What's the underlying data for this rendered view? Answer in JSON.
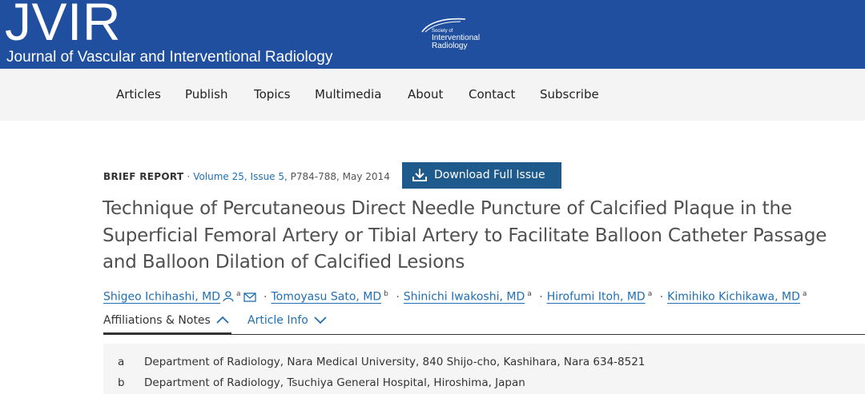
{
  "header": {
    "logo": "JVIR",
    "journal_name": "Journal of Vascular and Interventional Radiology",
    "society_small": "Society of",
    "society_line1": "Interventional",
    "society_line2": "Radiology"
  },
  "nav": {
    "items": [
      "Articles",
      "Publish",
      "Topics",
      "Multimedia",
      "About",
      "Contact",
      "Subscribe"
    ]
  },
  "article": {
    "type": "BRIEF REPORT",
    "issue": "Volume 25, Issue 5,",
    "pages_date": "P784-788, May 2014",
    "download_label": "Download Full Issue",
    "title": "Technique of Percutaneous Direct Needle Puncture of Calcified Plaque in the Superficial Femoral Artery or Tibial Artery to Facilitate Balloon Catheter Passage and Balloon Dilation of Calcified Lesions",
    "authors": [
      {
        "name": "Shigeo Ichihashi, MD",
        "sup": "a"
      },
      {
        "name": "Tomoyasu Sato, MD",
        "sup": "b"
      },
      {
        "name": "Shinichi Iwakoshi, MD",
        "sup": "a"
      },
      {
        "name": "Hirofumi Itoh, MD",
        "sup": "a"
      },
      {
        "name": "Kimihiko Kichikawa, MD",
        "sup": "a"
      }
    ],
    "separator": "·"
  },
  "tabs": {
    "affiliations": "Affiliations & Notes",
    "article_info": "Article Info"
  },
  "affiliations": [
    {
      "label": "a",
      "text": "Department of Radiology, Nara Medical University, 840 Shijo-cho, Kashihara, Nara 634-8521"
    },
    {
      "label": "b",
      "text": "Department of Radiology, Tsuchiya General Hospital, Hiroshima, Japan"
    }
  ],
  "colors": {
    "header_bg": "#1f4f9e",
    "link": "#1f6fb2",
    "button_bg": "#1f5a8c"
  }
}
